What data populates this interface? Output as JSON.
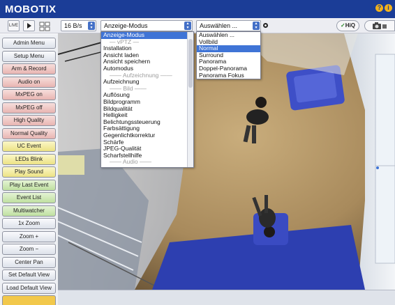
{
  "header": {
    "brand": "MOBOTIX",
    "help_icon": "?",
    "info_icon": "i"
  },
  "toolbar": {
    "live_label": "LIVE",
    "play_icon": "play-icon",
    "grid_icon": "grid-icon",
    "framerate_value": "16 B/s",
    "mode_value": "Anzeige-Modus",
    "view_value": "Auswählen ...",
    "hiq_label": "HiQ",
    "camera_icon": "camera-icon"
  },
  "mode_menu": {
    "items": [
      {
        "label": "Anzeige-Modus",
        "type": "selected"
      },
      {
        "label": "— vPTZ —",
        "type": "separator"
      },
      {
        "label": "Installation",
        "type": "item"
      },
      {
        "label": "Ansicht laden",
        "type": "item"
      },
      {
        "label": "Ansicht speichern",
        "type": "item"
      },
      {
        "label": "Automodus",
        "type": "item"
      },
      {
        "label": "—— Aufzeichnung ——",
        "type": "separator"
      },
      {
        "label": "Aufzeichnung",
        "type": "item"
      },
      {
        "label": "—— Bild ——",
        "type": "separator"
      },
      {
        "label": "Auflösung",
        "type": "item"
      },
      {
        "label": "Bildprogramm",
        "type": "item"
      },
      {
        "label": "Bildqualität",
        "type": "item"
      },
      {
        "label": "Helligkeit",
        "type": "item"
      },
      {
        "label": "Belichtungssteuerung",
        "type": "item"
      },
      {
        "label": "Farbsättigung",
        "type": "item"
      },
      {
        "label": "Gegenlichtkorrektur",
        "type": "item"
      },
      {
        "label": "Schärfe",
        "type": "item"
      },
      {
        "label": "JPEG-Qualität",
        "type": "item"
      },
      {
        "label": "Scharfstellhilfe",
        "type": "item"
      },
      {
        "label": "—— Audio ——",
        "type": "separator"
      }
    ]
  },
  "view_menu": {
    "items": [
      {
        "label": "Auswählen ...",
        "type": "item"
      },
      {
        "label": "Vollbild",
        "type": "item"
      },
      {
        "label": "Normal",
        "type": "selected"
      },
      {
        "label": "Surround",
        "type": "item"
      },
      {
        "label": "Panorama",
        "type": "item"
      },
      {
        "label": "Doppel-Panorama",
        "type": "item"
      },
      {
        "label": "Panorama Fokus",
        "type": "item"
      }
    ]
  },
  "sidebar": {
    "buttons": [
      {
        "label": "Admin Menu",
        "color": "white"
      },
      {
        "label": "Setup Menu",
        "color": "white"
      },
      {
        "label": "Arm & Record",
        "color": "red"
      },
      {
        "label": "Audio on",
        "color": "red"
      },
      {
        "label": "MxPEG on",
        "color": "red"
      },
      {
        "label": "MxPEG off",
        "color": "red"
      },
      {
        "label": "High Quality",
        "color": "red"
      },
      {
        "label": "Normal Quality",
        "color": "red"
      },
      {
        "label": "UC Event",
        "color": "yellow"
      },
      {
        "label": "LEDs Blink",
        "color": "yellow"
      },
      {
        "label": "Play Sound",
        "color": "yellow"
      },
      {
        "label": "Play Last Event",
        "color": "green"
      },
      {
        "label": "Event List",
        "color": "green"
      },
      {
        "label": "Multiwatcher",
        "color": "green"
      },
      {
        "label": "1x Zoom",
        "color": "white"
      },
      {
        "label": "Zoom +",
        "color": "white"
      },
      {
        "label": "Zoom −",
        "color": "white"
      },
      {
        "label": "Center Pan",
        "color": "white"
      },
      {
        "label": "Set Default View",
        "color": "white"
      },
      {
        "label": "Load Default View",
        "color": "white"
      },
      {
        "label": "",
        "color": "gold"
      }
    ]
  }
}
